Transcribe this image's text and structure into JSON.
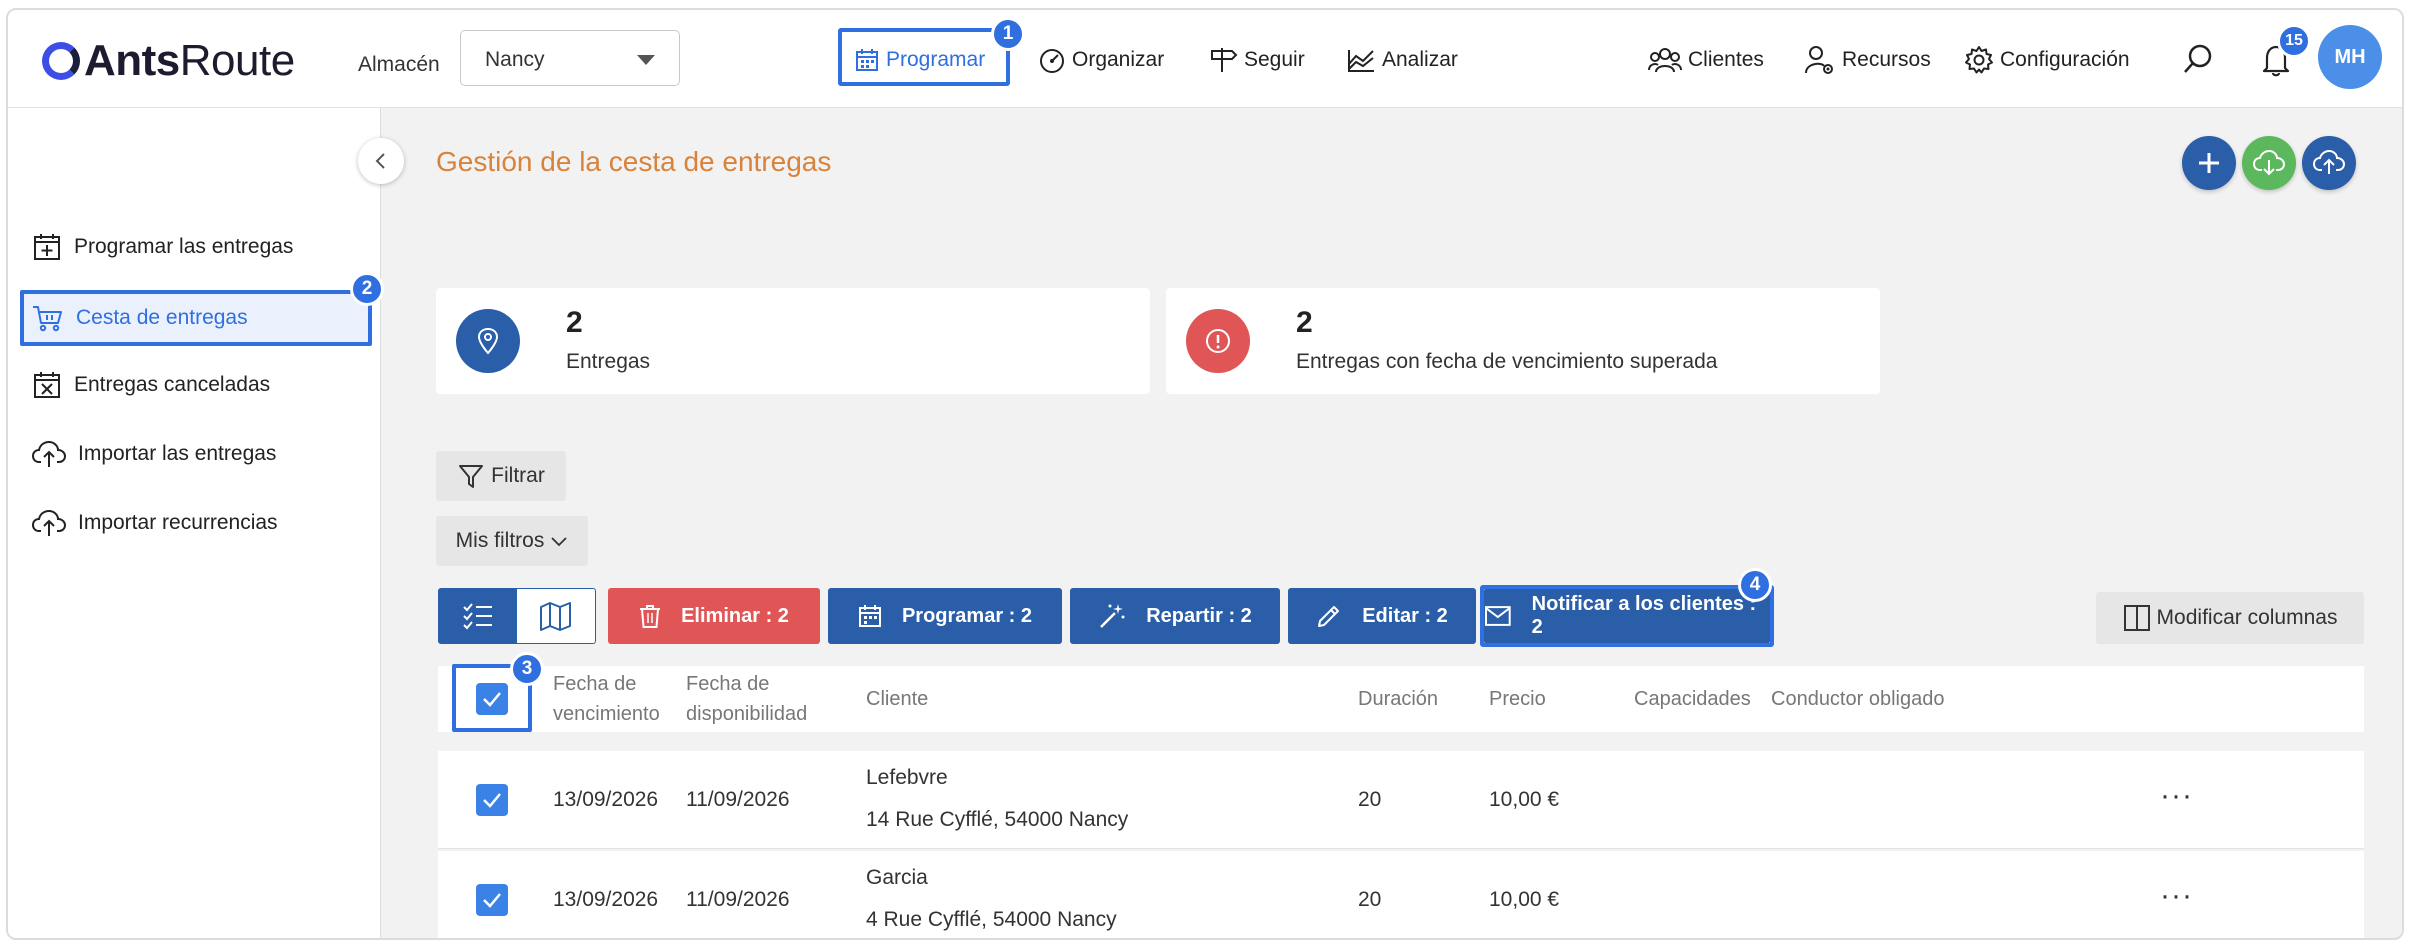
{
  "header": {
    "logo_bold": "Ants",
    "logo_rest": "Route",
    "warehouse_label": "Almacén",
    "warehouse_value": "Nancy",
    "nav": [
      {
        "label": "Programar",
        "icon": "calendar-icon",
        "active": true
      },
      {
        "label": "Organizar",
        "icon": "gauge-icon"
      },
      {
        "label": "Seguir",
        "icon": "signpost-icon"
      },
      {
        "label": "Analizar",
        "icon": "chart-icon"
      }
    ],
    "right_nav": [
      {
        "label": "Clientes",
        "icon": "users-icon"
      },
      {
        "label": "Recursos",
        "icon": "user-gear-icon"
      },
      {
        "label": "Configuración",
        "icon": "gear-icon"
      }
    ],
    "notifications_count": "15",
    "avatar_initials": "MH"
  },
  "step_badges": {
    "one": "1",
    "two": "2",
    "three": "3",
    "four": "4"
  },
  "sidebar": {
    "items": [
      {
        "label": "Programar las entregas",
        "icon": "calendar-plus-icon"
      },
      {
        "label": "Cesta de entregas",
        "icon": "cart-icon",
        "active": true
      },
      {
        "label": "Entregas canceladas",
        "icon": "calendar-x-icon"
      },
      {
        "label": "Importar las entregas",
        "icon": "cloud-upload-icon"
      },
      {
        "label": "Importar recurrencias",
        "icon": "cloud-upload-icon"
      }
    ]
  },
  "main": {
    "title": "Gestión de la cesta de entregas",
    "kpis": [
      {
        "value": "2",
        "label": "Entregas",
        "color": "#2a5ea8"
      },
      {
        "value": "2",
        "label": "Entregas con fecha de vencimiento superada",
        "color": "#e05656"
      }
    ],
    "filter_label": "Filtrar",
    "my_filters_label": "Mis filtros",
    "actions": {
      "delete": "Eliminar : 2",
      "schedule": "Programar : 2",
      "distribute": "Repartir : 2",
      "edit": "Editar : 2",
      "notify": "Notificar a los clientes : 2"
    },
    "modify_columns": "Modificar columnas",
    "table": {
      "headers": {
        "due_line1": "Fecha de",
        "due_line2": "vencimiento",
        "avail_line1": "Fecha de",
        "avail_line2": "disponibilidad",
        "client": "Cliente",
        "duration": "Duración",
        "price": "Precio",
        "capacities": "Capacidades",
        "driver": "Conductor obligado"
      },
      "rows": [
        {
          "due": "13/09/2026",
          "available": "11/09/2026",
          "client": "Lefebvre",
          "address": "14 Rue Cyfflé, 54000 Nancy",
          "duration": "20",
          "price": "10,00 €",
          "more": "···"
        },
        {
          "due": "13/09/2026",
          "available": "11/09/2026",
          "client": "Garcia",
          "address": "4 Rue Cyfflé, 54000 Nancy",
          "duration": "20",
          "price": "10,00 €",
          "more": "···"
        }
      ]
    }
  },
  "colors": {
    "accent": "#2f6fe0",
    "primary_button": "#2a5ea8",
    "danger": "#e05656",
    "title": "#d9833a",
    "success": "#5cb85c"
  }
}
